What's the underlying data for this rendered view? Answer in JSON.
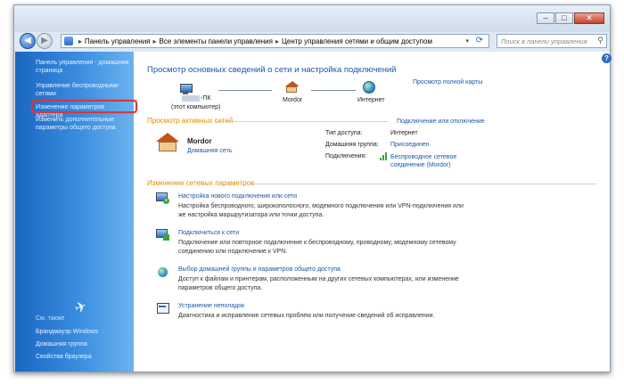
{
  "window": {
    "buttons": {
      "minimize": "–",
      "maximize": "□",
      "close": "✕"
    }
  },
  "address_bar": {
    "breadcrumbs": [
      "Панель управления",
      "Все элементы панели управления",
      "Центр управления сетями и общим доступом"
    ],
    "search_placeholder": "Поиск в панели управления"
  },
  "sidebar": {
    "items": [
      {
        "label": "Панель управления - домашняя страница"
      },
      {
        "label": "Управление беспроводными сетями"
      },
      {
        "label": "Изменение параметров адаптера"
      },
      {
        "label": "Изменить дополнительные параметры общего доступа"
      }
    ],
    "see_also_title": "См. также",
    "see_also": [
      {
        "label": "Брандмауэр Windows"
      },
      {
        "label": "Домашняя группа"
      },
      {
        "label": "Свойства браузера"
      }
    ]
  },
  "main": {
    "title": "Просмотр основных сведений о сети и настройка подключений",
    "full_map_link": "Просмотр полной карты",
    "map": {
      "computer_name": "-ПК",
      "computer_caption": "(этот компьютер)",
      "network_name": "Mordor",
      "internet_label": "Интернет"
    },
    "active_networks": {
      "title": "Просмотр активных сетей",
      "connect_link": "Подключение или отключение",
      "network_name": "Mordor",
      "network_type": "Домашняя сеть",
      "access_type_label": "Тип доступа:",
      "access_type_value": "Интернет",
      "homegroup_label": "Домашняя группа:",
      "homegroup_value": "Присоединен",
      "connections_label": "Подключения:",
      "connections_value": "Беспроводное сетевое соединение (Mordor)"
    },
    "change_settings": {
      "title": "Изменение сетевых параметров",
      "tasks": [
        {
          "title": "Настройка нового подключения или сети",
          "desc": "Настройка беспроводного, широкополосного, модемного подключения или VPN-подключения или же настройка маршрутизатора или точки доступа."
        },
        {
          "title": "Подключиться к сети",
          "desc": "Подключение или повторное подключение к беспроводному, проводному, модемному сетевому соединению или подключение к VPN."
        },
        {
          "title": "Выбор домашней группы и параметров общего доступа",
          "desc": "Доступ к файлам и принтерам, расположенным на других сетевых компьютерах, или изменение параметров общего доступа."
        },
        {
          "title": "Устранение неполадок",
          "desc": "Диагностика и исправление сетевых проблем или получение сведений об исправлении."
        }
      ]
    }
  },
  "colors": {
    "link": "#1c56a8",
    "heading_orange": "#e58a00",
    "highlight": "#d6363f",
    "sidebar": "#2a7ad4"
  }
}
